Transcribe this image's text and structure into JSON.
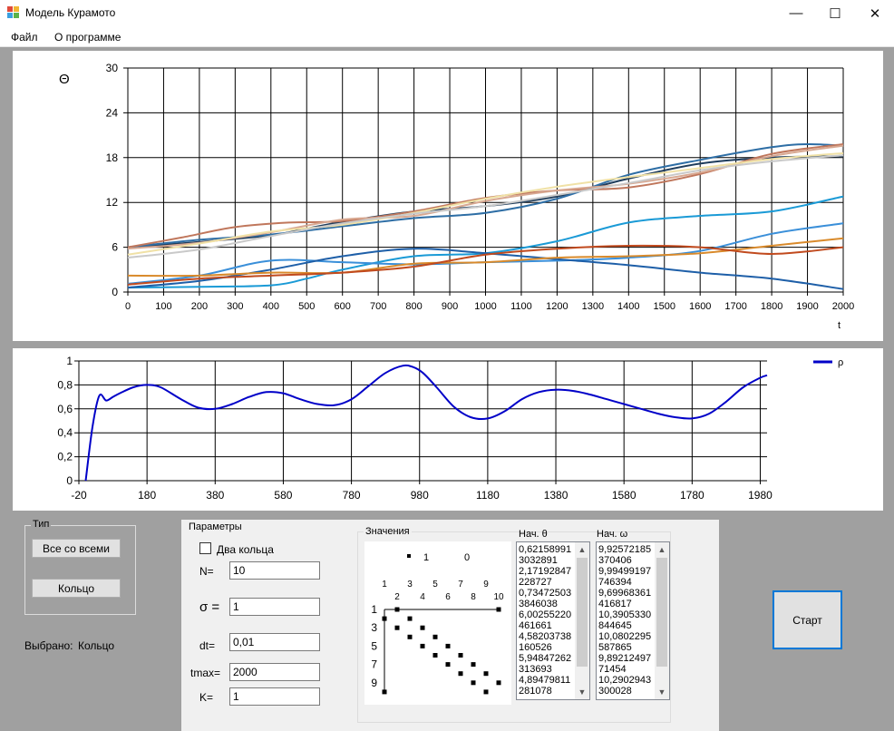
{
  "window": {
    "title": "Модель Курамото",
    "minimize": "—",
    "maximize": "☐",
    "close": "✕"
  },
  "menu": [
    "Файл",
    "О программе"
  ],
  "theta_chart": {
    "type": "line",
    "ylabel": "Θ",
    "xlabel": "t",
    "xlim": [
      0,
      2000
    ],
    "ylim": [
      0,
      30
    ],
    "x_ticks": [
      "0",
      "100",
      "200",
      "300",
      "400",
      "500",
      "600",
      "700",
      "800",
      "900",
      "1000",
      "1100",
      "1200",
      "1300",
      "1400",
      "1500",
      "1600",
      "1700",
      "1800",
      "1900",
      "2000"
    ],
    "y_ticks": [
      "0",
      "6",
      "12",
      "18",
      "24",
      "30"
    ],
    "grid": true,
    "series": [
      {
        "color": "#1f3d5c",
        "x": [
          0,
          200,
          400,
          500,
          600,
          800,
          1000,
          1200,
          1400,
          1600,
          1800,
          2000
        ],
        "y": [
          6,
          6.7,
          7.6,
          8.5,
          9.4,
          10.8,
          11.5,
          12.8,
          15.2,
          17.2,
          18.0,
          18.2
        ]
      },
      {
        "color": "#2e6ea5",
        "x": [
          0,
          200,
          400,
          600,
          800,
          1000,
          1200,
          1400,
          1600,
          1800,
          1900,
          2000
        ],
        "y": [
          6,
          7.0,
          7.7,
          8.8,
          9.9,
          10.6,
          12.5,
          15.7,
          17.7,
          19.4,
          19.8,
          19.6
        ]
      },
      {
        "color": "#c0775c",
        "x": [
          0,
          150,
          300,
          450,
          600,
          800,
          1000,
          1200,
          1400,
          1600,
          1800,
          2000
        ],
        "y": [
          6,
          7.3,
          8.7,
          9.3,
          9.5,
          10.8,
          12.6,
          13.6,
          14.0,
          15.8,
          18.5,
          19.8
        ]
      },
      {
        "color": "#d8a891",
        "x": [
          0,
          200,
          400,
          600,
          800,
          1000,
          1200,
          1400,
          1600,
          1800,
          2000
        ],
        "y": [
          5.8,
          6.6,
          8.0,
          9.7,
          10.2,
          12.2,
          13.6,
          14.5,
          16.0,
          18.2,
          19.6
        ]
      },
      {
        "color": "#f0e1a6",
        "x": [
          0,
          200,
          400,
          600,
          800,
          1000,
          1200,
          1400,
          1600,
          1800,
          2000
        ],
        "y": [
          5.0,
          6.5,
          8.1,
          9.0,
          10.6,
          12.5,
          14.1,
          15.4,
          16.6,
          17.8,
          18.6
        ]
      },
      {
        "color": "#c9c9c9",
        "x": [
          0,
          200,
          400,
          600,
          800,
          1000,
          1200,
          1400,
          1600,
          1800,
          2000
        ],
        "y": [
          4.6,
          5.7,
          7.5,
          9.2,
          10.5,
          11.5,
          13.0,
          14.6,
          16.3,
          17.5,
          18.3
        ]
      },
      {
        "color": "#1a9ad6",
        "x": [
          0,
          200,
          400,
          500,
          600,
          800,
          1000,
          1200,
          1400,
          1600,
          1800,
          2000
        ],
        "y": [
          0.6,
          0.7,
          0.9,
          1.8,
          3.0,
          4.8,
          5.2,
          6.8,
          9.3,
          10.2,
          10.8,
          12.8
        ]
      },
      {
        "color": "#3a8fd9",
        "x": [
          0,
          200,
          400,
          600,
          800,
          1000,
          1200,
          1400,
          1600,
          1800,
          2000
        ],
        "y": [
          1.1,
          2.2,
          4.2,
          4.0,
          3.7,
          4.0,
          4.2,
          4.6,
          5.5,
          7.8,
          9.2
        ]
      },
      {
        "color": "#1e5fa8",
        "x": [
          0,
          200,
          400,
          600,
          800,
          1000,
          1200,
          1400,
          1600,
          1800,
          2000
        ],
        "y": [
          0.6,
          1.5,
          3.0,
          4.8,
          5.8,
          5.2,
          4.4,
          3.6,
          2.6,
          1.8,
          0.4
        ]
      },
      {
        "color": "#d98a2b",
        "x": [
          0,
          200,
          400,
          600,
          800,
          1000,
          1200,
          1400,
          1600,
          1800,
          2000
        ],
        "y": [
          2.2,
          2.2,
          2.6,
          2.6,
          3.8,
          4.0,
          4.6,
          4.8,
          5.2,
          6.2,
          7.2
        ]
      },
      {
        "color": "#c14a1e",
        "x": [
          0,
          200,
          400,
          600,
          800,
          1000,
          1200,
          1400,
          1600,
          1800,
          2000
        ],
        "y": [
          1.0,
          1.8,
          2.2,
          2.6,
          3.4,
          5.0,
          5.8,
          6.2,
          6.0,
          5.1,
          6.0
        ]
      }
    ]
  },
  "rho_chart": {
    "type": "line",
    "legend": "ρ",
    "xlim": [
      -20,
      2000
    ],
    "ylim": [
      0,
      1
    ],
    "x_ticks": [
      "-20",
      "180",
      "380",
      "580",
      "780",
      "980",
      "1180",
      "1380",
      "1580",
      "1780",
      "1980"
    ],
    "y_ticks": [
      "0",
      "0,2",
      "0,4",
      "0,6",
      "0,8",
      "1"
    ],
    "grid": true,
    "series": [
      {
        "name": "ρ",
        "color": "#0000c8",
        "x": [
          0,
          20,
          40,
          60,
          80,
          100,
          140,
          180,
          220,
          280,
          330,
          380,
          430,
          480,
          530,
          580,
          630,
          680,
          730,
          780,
          830,
          880,
          930,
          960,
          990,
          1030,
          1080,
          1130,
          1180,
          1230,
          1280,
          1330,
          1380,
          1430,
          1480,
          1530,
          1580,
          1630,
          1680,
          1730,
          1780,
          1830,
          1880,
          1930,
          1980,
          2000
        ],
        "y": [
          0,
          0.45,
          0.71,
          0.67,
          0.7,
          0.73,
          0.78,
          0.8,
          0.78,
          0.68,
          0.61,
          0.6,
          0.64,
          0.7,
          0.74,
          0.73,
          0.68,
          0.64,
          0.63,
          0.68,
          0.79,
          0.9,
          0.96,
          0.95,
          0.9,
          0.78,
          0.62,
          0.53,
          0.52,
          0.58,
          0.68,
          0.74,
          0.76,
          0.75,
          0.72,
          0.68,
          0.64,
          0.6,
          0.56,
          0.53,
          0.52,
          0.56,
          0.66,
          0.78,
          0.86,
          0.88
        ]
      }
    ]
  },
  "type_group": {
    "title": "Тип",
    "btn_all": "Все со всеми",
    "btn_ring": "Кольцо",
    "selected_label": "Выбрано:",
    "selected_value": "Кольцо"
  },
  "params": {
    "title": "Параметры",
    "two_rings": "Два кольца",
    "n_label": "N=",
    "n_value": "10",
    "sigma_label": "σ =",
    "sigma_value": "1",
    "dt_label": "dt=",
    "dt_value": "0,01",
    "tmax_label": "tmax=",
    "tmax_value": "2000",
    "k_label": "K=",
    "k_value": "1",
    "values_title": "Значения",
    "theta0_title": "Нач. θ",
    "omega0_title": "Нач. ω",
    "theta0": [
      "0,62158991",
      "3032891",
      "2,17192847",
      "228727",
      "0,73472503",
      "3846038",
      "6,00255220",
      "461661",
      "4,58203738",
      "160526",
      "5,94847262",
      "313693",
      "4,89479811",
      "281078"
    ],
    "omega0": [
      "9,92572185",
      "370406",
      "9,99499197",
      "746394",
      "9,69968361",
      "416817",
      "10,3905330",
      "844645",
      "10,0802295",
      "587865",
      "9,89212497",
      "71454",
      "10,2902943",
      "300028"
    ]
  },
  "legend_matrix": {
    "legend_col": "1",
    "legend_val": "0",
    "top_ticks_odd": [
      "1",
      "3",
      "5",
      "7",
      "9"
    ],
    "top_ticks_even": [
      "2",
      "4",
      "6",
      "8",
      "10"
    ],
    "left_ticks": [
      "1",
      "3",
      "5",
      "7",
      "9"
    ]
  },
  "start_button": "Старт"
}
